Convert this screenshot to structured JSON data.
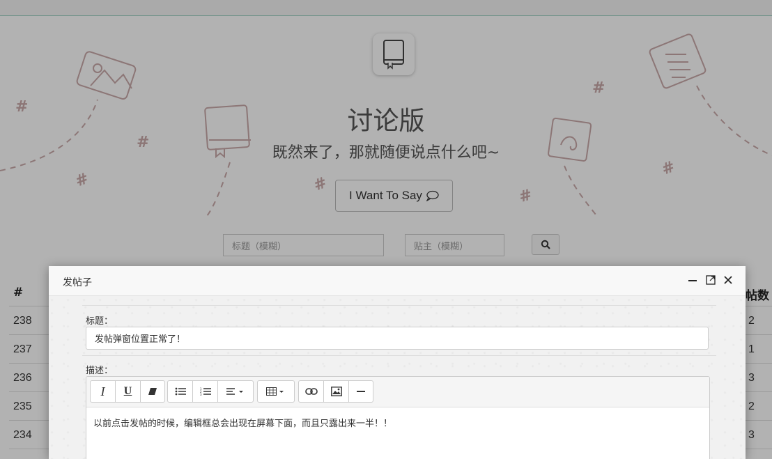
{
  "hero": {
    "title": "讨论版",
    "subtitle": "既然来了，那就随便说点什么吧~",
    "say_button": "I Want To Say",
    "icon": "book-icon"
  },
  "search": {
    "title_placeholder": "标题（模糊）",
    "author_placeholder": "贴主（模糊）",
    "button_icon": "search-icon"
  },
  "table": {
    "col_id": "#",
    "col_replies": "帖数",
    "rows": [
      {
        "id": "238",
        "count": "2"
      },
      {
        "id": "237",
        "count": "1"
      },
      {
        "id": "236",
        "count": "3"
      },
      {
        "id": "235",
        "count": "2"
      },
      {
        "id": "234",
        "count": "3"
      }
    ]
  },
  "modal": {
    "title": "发帖子",
    "title_label": "标题：",
    "title_value": "发帖弹窗位置正常了！",
    "desc_label": "描述：",
    "desc_value": "以前点击发帖的时候，编辑框总会出现在屏幕下面，而且只露出来一半！！",
    "toolbar": {
      "italic": "I",
      "underline": "U"
    }
  },
  "colors": {
    "overlay": "#000000",
    "accent_line": "#9fd2c4"
  }
}
